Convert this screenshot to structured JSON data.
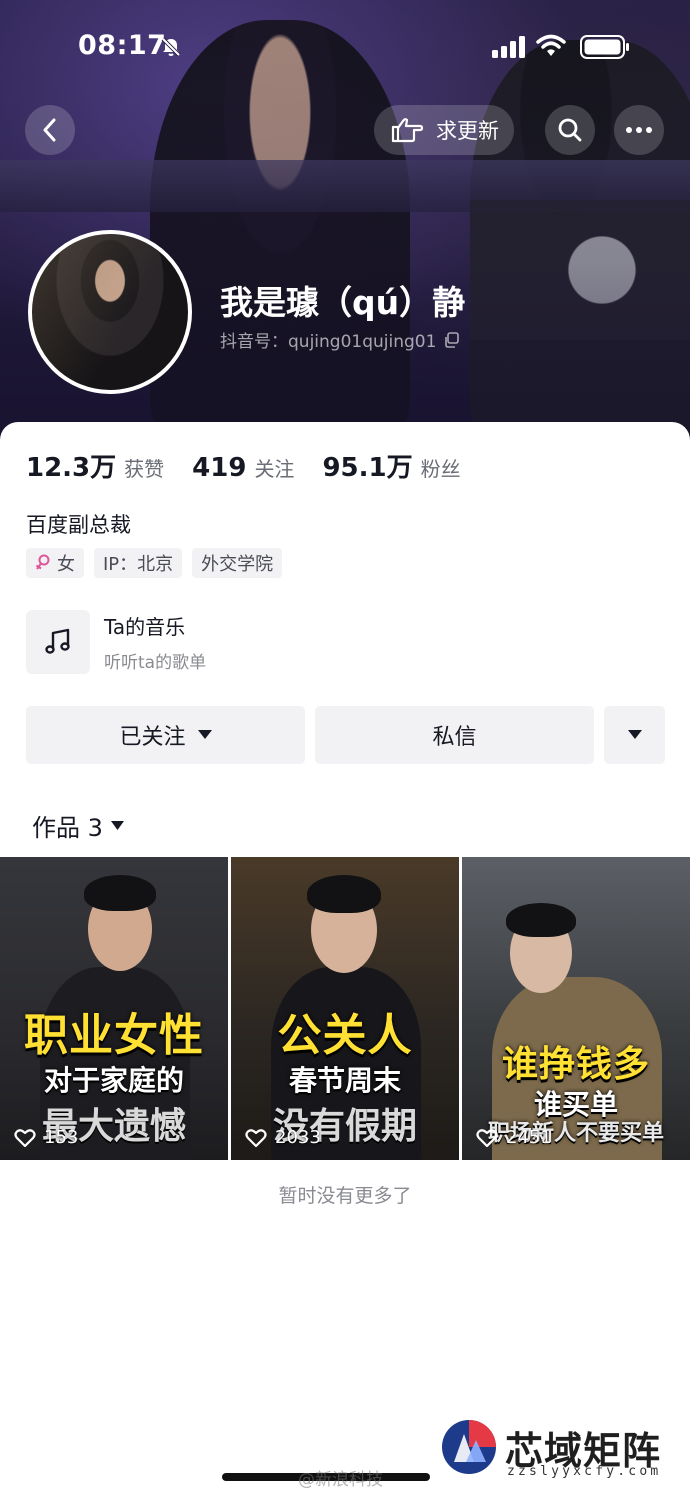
{
  "status_bar": {
    "time": "08:17"
  },
  "header": {
    "request_update_label": "求更新"
  },
  "profile": {
    "display_name": "我是璩（qú）静",
    "douyin_id": "抖音号：qujing01qujing01",
    "stats": [
      {
        "value": "12.3万",
        "label": "获赞"
      },
      {
        "value": "419",
        "label": "关注"
      },
      {
        "value": "95.1万",
        "label": "粉丝"
      }
    ],
    "bio": "百度副总裁",
    "tags": [
      "女",
      "IP：北京",
      "外交学院"
    ]
  },
  "music": {
    "title": "Ta的音乐",
    "subtitle": "听听ta的歌单"
  },
  "actions": {
    "follow_label": "已关注",
    "message_label": "私信"
  },
  "works": {
    "tab_label": "作品 3"
  },
  "videos": [
    {
      "line1": "职业女性",
      "line2": "对于家庭的",
      "line3": "最大遗憾",
      "likes": "153"
    },
    {
      "line1": "公关人",
      "line2": "春节周末",
      "line3": "没有假期",
      "likes": "2033"
    },
    {
      "line1": "谁挣钱多",
      "line2": "谁买单",
      "line3": "职场新人不要买单",
      "likes": "2451"
    }
  ],
  "footer": {
    "no_more": "暂时没有更多了",
    "watermark": "@新浪科技"
  },
  "site_badge": {
    "name": "芯域矩阵",
    "url": "zzslyyxcfy.com"
  },
  "colors": {
    "accent_title": "#ffe033",
    "gender_icon": "#e0559a",
    "text_primary": "#161823",
    "text_secondary": "#8a8b91"
  }
}
